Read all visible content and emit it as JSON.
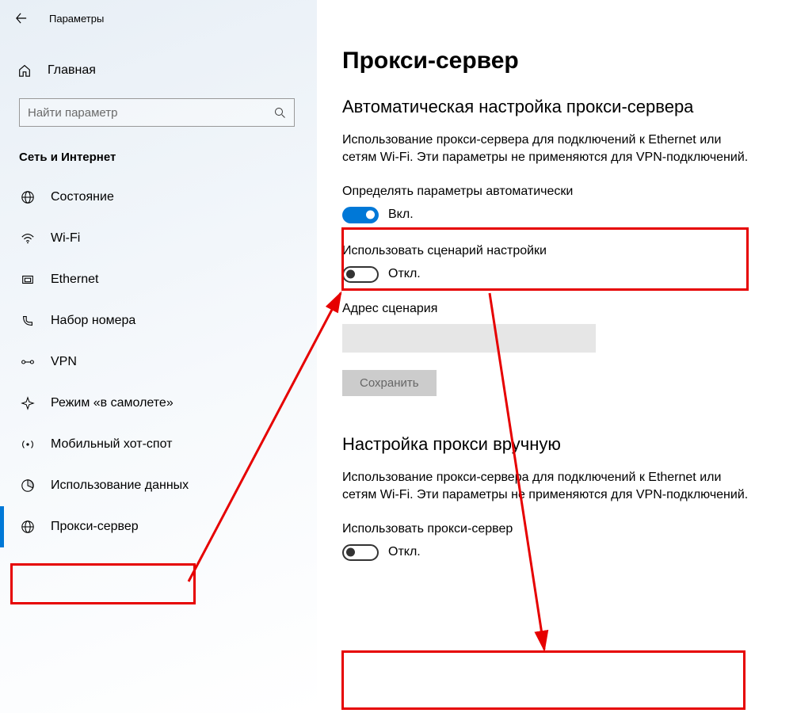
{
  "titlebar": {
    "label": "Параметры"
  },
  "home": {
    "label": "Главная"
  },
  "search": {
    "placeholder": "Найти параметр"
  },
  "section": {
    "label": "Сеть и Интернет"
  },
  "nav": {
    "items": [
      {
        "id": "status",
        "label": "Состояние"
      },
      {
        "id": "wifi",
        "label": "Wi-Fi"
      },
      {
        "id": "ethernet",
        "label": "Ethernet"
      },
      {
        "id": "dialup",
        "label": "Набор номера"
      },
      {
        "id": "vpn",
        "label": "VPN"
      },
      {
        "id": "airplane",
        "label": "Режим «в самолете»"
      },
      {
        "id": "hotspot",
        "label": "Мобильный хот-спот"
      },
      {
        "id": "data",
        "label": "Использование данных"
      },
      {
        "id": "proxy",
        "label": "Прокси-сервер"
      }
    ]
  },
  "main": {
    "title": "Прокси-сервер",
    "auto": {
      "heading": "Автоматическая настройка прокси-сервера",
      "desc": "Использование прокси-сервера для подключений к Ethernet или сетям Wi-Fi. Эти параметры не применяются для VPN-подключений.",
      "detect": {
        "label": "Определять параметры автоматически",
        "state": "Вкл."
      },
      "script": {
        "label": "Использовать сценарий настройки",
        "state": "Откл."
      },
      "scriptAddr": {
        "label": "Адрес сценария"
      },
      "save": "Сохранить"
    },
    "manual": {
      "heading": "Настройка прокси вручную",
      "desc": "Использование прокси-сервера для подключений к Ethernet или сетям Wi-Fi. Эти параметры не применяются для VPN-подключений.",
      "use": {
        "label": "Использовать прокси-сервер",
        "state": "Откл."
      }
    }
  }
}
